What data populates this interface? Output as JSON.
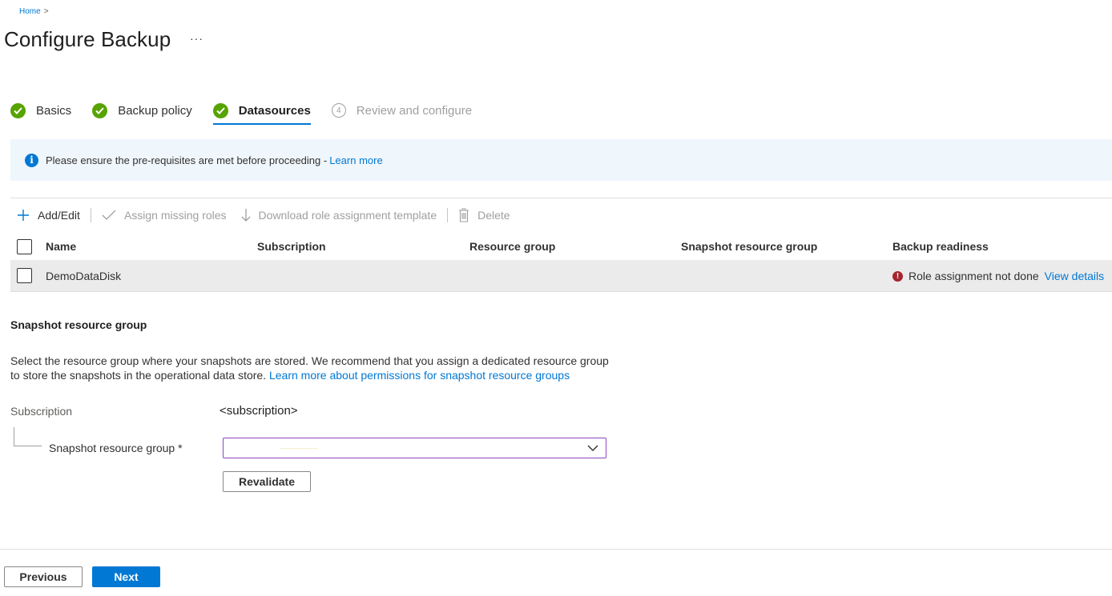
{
  "breadcrumb": {
    "home": "Home",
    "separator": ">"
  },
  "page": {
    "title": "Configure Backup",
    "more": "···"
  },
  "tabs": [
    {
      "label": "Basics",
      "state": "complete"
    },
    {
      "label": "Backup policy",
      "state": "complete"
    },
    {
      "label": "Datasources",
      "state": "active"
    },
    {
      "label": "Review and configure",
      "state": "disabled",
      "number": "4"
    }
  ],
  "info": {
    "text": "Please ensure the pre-requisites are met before proceeding - ",
    "link": "Learn more"
  },
  "toolbar": {
    "add_edit": "Add/Edit",
    "assign_roles": "Assign missing roles",
    "download_template": "Download role assignment template",
    "delete": "Delete"
  },
  "table": {
    "columns": [
      "Name",
      "Subscription",
      "Resource group",
      "Snapshot resource group",
      "Backup readiness"
    ],
    "rows": [
      {
        "name": "DemoDataDisk",
        "subscription": "",
        "resource_group": "",
        "snapshot_resource_group": "",
        "readiness_text": "Role assignment not done",
        "readiness_link": "View details",
        "readiness_status": "error"
      }
    ]
  },
  "snapshot": {
    "title": "Snapshot resource group",
    "description": "Select the resource group where your snapshots are stored. We recommend that you assign a dedicated resource group to store the snapshots in the operational data store. ",
    "description_link": "Learn more about permissions for snapshot resource groups",
    "subscription_label": "Subscription",
    "subscription_value": "<subscription>",
    "rg_label": "Snapshot resource group *",
    "rg_value": "",
    "revalidate": "Revalidate"
  },
  "footer": {
    "previous": "Previous",
    "next": "Next"
  },
  "colors": {
    "accent": "#0078d4",
    "success": "#57a300",
    "error": "#a4262c",
    "info_bg": "#eff6fc",
    "focus_border": "#8a47c2"
  }
}
